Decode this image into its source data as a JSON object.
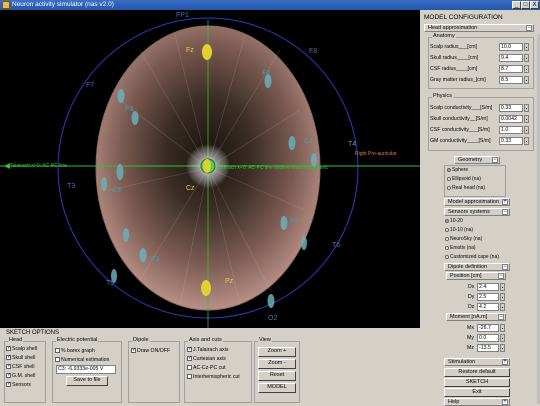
{
  "window": {
    "title": "Neuron activity simulator (nas v2.0)",
    "controls": [
      "_",
      "□",
      "X"
    ]
  },
  "view": {
    "electrodes_side": [
      "FP1",
      "F8",
      "F7",
      "F3",
      "F4",
      "C4",
      "T4",
      "C3",
      "T3",
      "P4",
      "P3",
      "T6",
      "T5",
      "O2"
    ],
    "electrodes_mid": [
      "Fz",
      "Cz",
      "Pz"
    ],
    "axis_left": "Talairach x=0: AC-PC line",
    "axis_center": "Talairach x=0: AC-PC line Midline interhemispheric",
    "axis_right": "Right Pre-auricular"
  },
  "config": {
    "title": "MODEL CONFIGURATION",
    "head_approx": "Head approximation",
    "anatomy": {
      "label": "Anatomy",
      "rows": [
        {
          "label": "Scalp radius",
          "unit": "[cm]",
          "value": "10.0"
        },
        {
          "label": "Skull radius",
          "unit": "[cm]",
          "value": "9.4"
        },
        {
          "label": "CSF radius",
          "unit": "[cm]",
          "value": "8.7"
        },
        {
          "label": "Gray matter radius",
          "unit": "[cm]",
          "value": "8.5"
        }
      ]
    },
    "physics": {
      "label": "Physics",
      "rows": [
        {
          "label": "Scalp conductivity",
          "unit": "[S/m]",
          "value": "0.33"
        },
        {
          "label": "Skull conductivity",
          "unit": "[S/m]",
          "value": "0.0042"
        },
        {
          "label": "CSF conductivity",
          "unit": "[S/m]",
          "value": "1.0"
        },
        {
          "label": "GM conductivity",
          "unit": "[S/m]",
          "value": "0.33"
        }
      ]
    },
    "geometry": {
      "label": "Geometry",
      "options": [
        "Sphere",
        "Ellipsoid (na)",
        "Real head (na)"
      ],
      "selected": 0
    },
    "model_approx": "Model approximation",
    "sensors": {
      "label": "Sensors systems",
      "options": [
        "10-20",
        "10-10 (na)",
        "NeuroSky (na)",
        "Emotiv (na)",
        "Customized cape (na)"
      ],
      "selected": 0
    },
    "dipole": {
      "label": "Dipole definition",
      "position_label": "Position [cm]",
      "position": [
        {
          "k": "Dx",
          "v": "2.4"
        },
        {
          "k": "Dy",
          "v": "2.5"
        },
        {
          "k": "Dz",
          "v": "4.2"
        }
      ],
      "moment_label": "Moment [nA.m]",
      "moment": [
        {
          "k": "Mx",
          "v": "-26.7"
        },
        {
          "k": "My",
          "v": "0.0"
        },
        {
          "k": "Mz",
          "v": "-13.5"
        }
      ]
    },
    "stimulation": "Stimulation",
    "restore": "Restore default",
    "sketch": "SKETCH",
    "exit": "Exit",
    "help": "Help"
  },
  "sketch": {
    "title": "SKETCH OPTIONS",
    "head": {
      "label": "Head",
      "items": [
        {
          "label": "Scalp shell",
          "checked": true
        },
        {
          "label": "Skull shell",
          "checked": true
        },
        {
          "label": "CSF shell",
          "checked": true
        },
        {
          "label": "G.M. shell",
          "checked": true
        },
        {
          "label": "Sensors",
          "checked": true
        }
      ]
    },
    "potential": {
      "label": "Electric potential",
      "items": [
        {
          "label": "% barex graph",
          "checked": false
        },
        {
          "label": "Numerical estimation",
          "checked": false
        }
      ],
      "value": "C3: -6.9333e-005 V",
      "save": "Save to file"
    },
    "dipole": {
      "label": "Dipole",
      "items": [
        {
          "label": "Draw ON/OFF",
          "checked": true
        }
      ]
    },
    "axis": {
      "label": "Axis and cuts",
      "items": [
        {
          "label": "J.Talairach axis",
          "checked": true
        },
        {
          "label": "Cartesian  axis",
          "checked": true
        },
        {
          "label": "AC-Cz-PC cut",
          "checked": false
        },
        {
          "label": "Interhemispheric cut",
          "checked": false
        }
      ]
    },
    "viewbox": {
      "label": "View",
      "buttons": [
        "Zoom +",
        "Zoom -",
        "Reset",
        "MODEL"
      ]
    }
  }
}
